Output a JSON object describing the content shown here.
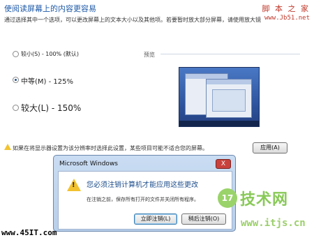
{
  "header": {
    "title": "使阅读屏幕上的内容更容易",
    "subtitle": "通过选择其中一个选项，可以更改屏幕上的文本大小以及其他项。若要暂时放大部分屏幕，请使用放大镜"
  },
  "watermark_top": {
    "brand": "脚 本 之 家",
    "url": "www.Jb51.net"
  },
  "options": [
    {
      "label": "较小(S) - 100% (默认)",
      "checked": false
    },
    {
      "label": "中等(M) - 125%",
      "checked": true
    },
    {
      "label": "较大(L) - 150%",
      "checked": false
    }
  ],
  "preview": {
    "label": "预览"
  },
  "warning": {
    "text": "如果在将显示器设置为该分辨率时选择此设置，某些项目可能不适合您的屏幕。"
  },
  "apply_button": "应用(A)",
  "dialog": {
    "title": "Microsoft Windows",
    "close": "X",
    "message": "您必须注销计算机才能应用这些更改",
    "detail": "在注销之前，保存所有打开的文件并关闭所有程序。",
    "logoff_now": "立即注销(L)",
    "logoff_later": "稍后注销(O)"
  },
  "watermark_bottom": {
    "left": "www.45IT.com",
    "logo": "17",
    "brand": "技术网",
    "url": "www.itjs.cn"
  },
  "colors": {
    "accent": "#1e5aa8",
    "warning": "#f2c230",
    "dialog_frame": "#b8cfea",
    "close": "#c9413d"
  }
}
